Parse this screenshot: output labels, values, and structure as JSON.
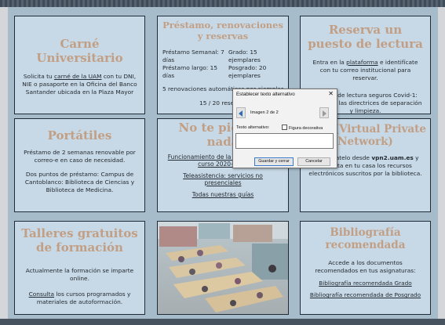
{
  "carne": {
    "title": "Carné Universitario",
    "pre": "Solicita tu ",
    "link": "carné de la UAM",
    "post": " con tu DNI, NIE o pasaporte en la Oficina del Banco Santander ubicada en la Plaza Mayor"
  },
  "prestamo": {
    "title": "Préstamo, renovaciones y reservas",
    "row1_left": "Préstamo Semanal: 7 días",
    "row1_right": "Grado: 15 ejemplares",
    "row2_left": "Préstamo largo: 15 días",
    "row2_right": "Posgrado: 20 ejemplares",
    "renov": "5 renovaciones automáticas por ejemplar",
    "reservas": "15 / 20 reservas"
  },
  "reserva": {
    "title": "Reserva un puesto de lectura",
    "pre": "Entra en la ",
    "link": "plataforma",
    "post": " e identifícate con tu correo institucional para reservar.",
    "covid": "Puestos de lectura seguros Covid-1: siguiendo las directrices de separación y limpieza."
  },
  "portatiles": {
    "title": "Portátiles",
    "p1": "Préstamo de 2 semanas renovable por correo-e en caso de necesidad.",
    "p2": "Dos puntos de préstamo: Campus de Cantoblanco: Biblioteca de Ciencias y Biblioteca de Medicina."
  },
  "noteimprimas": {
    "title": "No te pierdas nada",
    "link1": "Funcionamiento de la biblioteca en el curso 2020-2021",
    "link2": "Teleasistencia: servicios no presenciales",
    "link3": "Todas nuestras guías"
  },
  "vpn": {
    "title": "VPN (Virtual Private Network)",
    "pre": "Descárgatelo desde ",
    "bold": "vpn2.uam.es",
    "post": " y consulta en tu casa los recursos electrónicos suscritos por la biblioteca."
  },
  "talleres": {
    "title": "Talleres gratuitos de formación",
    "p1": "Actualmente la formación se imparte online.",
    "link": "Consulta",
    "post": " los cursos programados y materiales de autoformación."
  },
  "biblio": {
    "title": "Bibliografía recomendada",
    "p1": "Accede a los documentos recomendados en tus asignaturas:",
    "link1": "Bibliografía recomendada Grado",
    "link2": "Bibliografía recomendada de Posgrado"
  },
  "dialog": {
    "title": "Establecer texto alternativo",
    "counter": "Imagen 2 de 2",
    "alt_label": "Texto alternativo:",
    "deco_label": "Figura decorativa",
    "alt_value": "",
    "ok": "Guardar y cerrar",
    "cancel": "Cancelar"
  },
  "colors": {
    "card_bg": "#c7d9e6",
    "title": "#c29f84",
    "workspace": "#a6bccb",
    "dialog_arrow": "#2f6db2"
  }
}
